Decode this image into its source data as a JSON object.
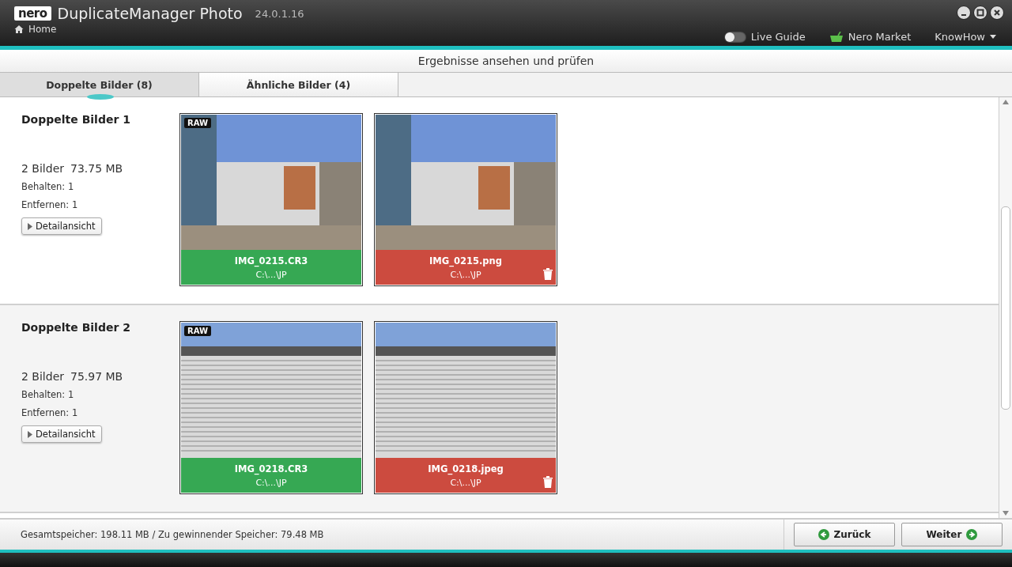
{
  "window": {
    "logo": "nero",
    "title": "DuplicateManager Photo",
    "version": "24.0.1.16",
    "home": "Home",
    "live_guide": {
      "label": "Live Guide",
      "on": false
    },
    "market": "Nero Market",
    "knowhow": "KnowHow"
  },
  "subtitle": "Ergebnisse ansehen und prüfen",
  "tabs": [
    {
      "label": "Doppelte Bilder (8)",
      "selected": true
    },
    {
      "label": "Ähnliche Bilder (4)",
      "selected": false
    }
  ],
  "groups": [
    {
      "title": "Doppelte Bilder 1",
      "count": "2 Bilder",
      "size": "73.75 MB",
      "kept": "Behalten: 1",
      "removed": "Entfernen: 1",
      "detail_button": "Detailansicht",
      "images": [
        {
          "badge": "RAW",
          "filename": "IMG_0215.CR3",
          "path": "C:\\...\\JP",
          "keep": true
        },
        {
          "filename": "IMG_0215.png",
          "path": "C:\\...\\JP",
          "keep": false
        }
      ]
    },
    {
      "title": "Doppelte Bilder 2",
      "count": "2 Bilder",
      "size": "75.97 MB",
      "kept": "Behalten: 1",
      "removed": "Entfernen: 1",
      "detail_button": "Detailansicht",
      "images": [
        {
          "badge": "RAW",
          "filename": "IMG_0218.CR3",
          "path": "C:\\...\\JP",
          "keep": true
        },
        {
          "filename": "IMG_0218.jpeg",
          "path": "C:\\...\\JP",
          "keep": false
        }
      ]
    }
  ],
  "status_bar": "Gesamtspeicher: 198.11 MB / Zu gewinnender Speicher: 79.48 MB",
  "buttons": [
    {
      "label": "Zurück",
      "kind": "back"
    },
    {
      "label": "Weiter",
      "kind": "next"
    }
  ]
}
